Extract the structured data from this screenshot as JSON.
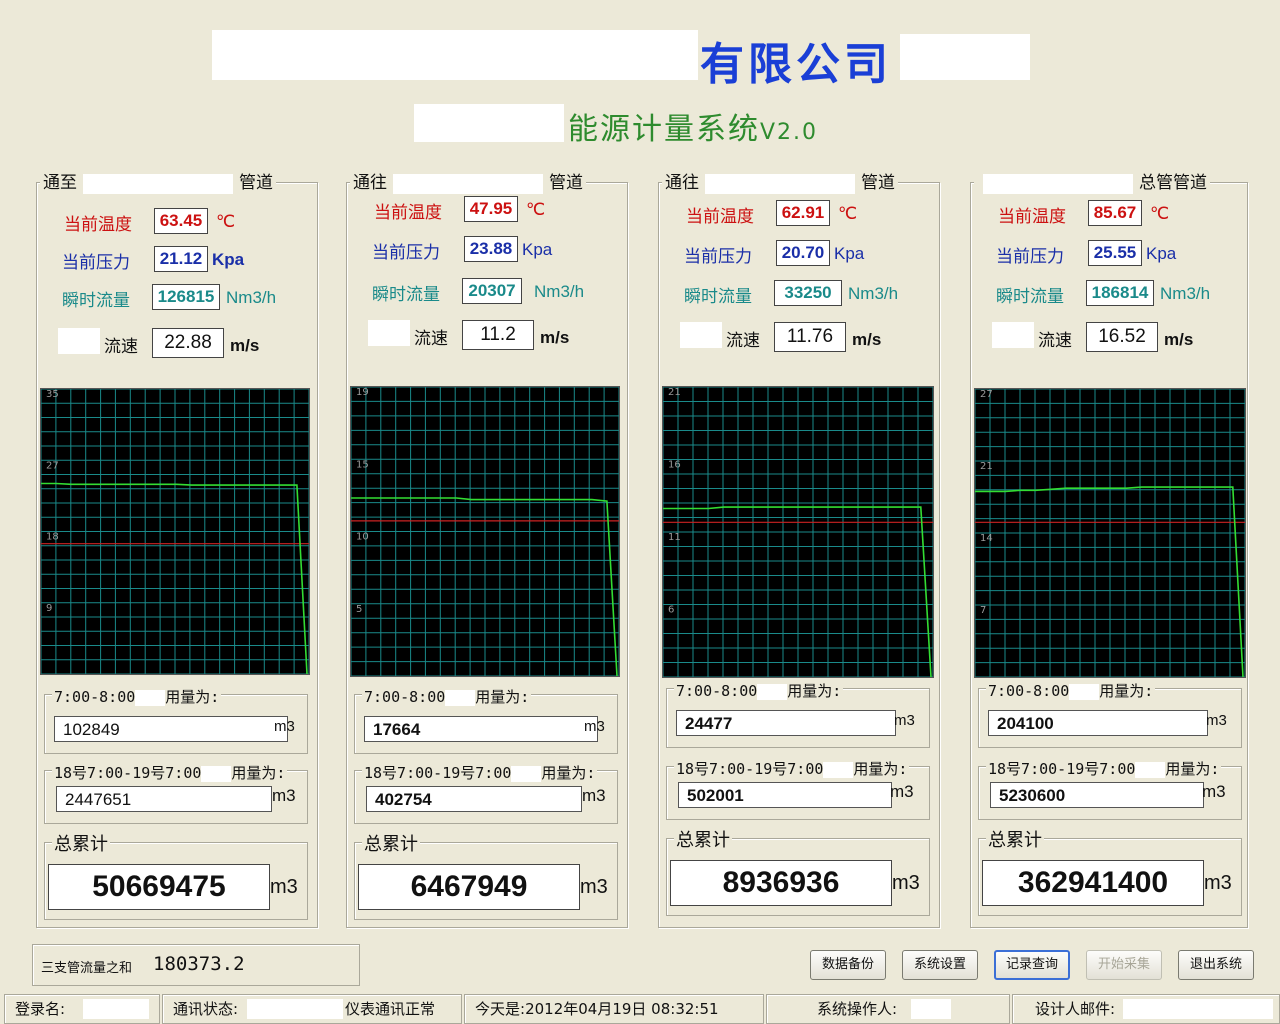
{
  "header": {
    "company": "有限公司",
    "system": "能源计量系统",
    "version": "V2.0"
  },
  "panels": [
    {
      "title_pre": "通至",
      "title_post": "管道",
      "temp_label": "当前温度",
      "temp": "63.45",
      "temp_unit": "℃",
      "pressure_label": "当前压力",
      "pressure": "21.12",
      "pressure_unit": "Kpa",
      "flow_label": "瞬时流量",
      "flow": "126815",
      "flow_unit": "Nm3/h",
      "speed_label": "流速",
      "speed": "22.88",
      "speed_unit": "m/s",
      "hour_label": "7:00-8:00",
      "hour_suffix": "用量为:",
      "hour_value": "102849",
      "day_label": "18号7:00-19号7:00",
      "day_suffix": "用量为:",
      "day_value": "2447651",
      "total_label": "总累计",
      "total": "50669475",
      "unit": "m3"
    },
    {
      "title_pre": "通往",
      "title_post": "管道",
      "temp_label": "当前温度",
      "temp": "47.95",
      "temp_unit": "℃",
      "pressure_label": "当前压力",
      "pressure": "23.88",
      "pressure_unit": "Kpa",
      "flow_label": "瞬时流量",
      "flow": "20307",
      "flow_unit": "Nm3/h",
      "speed_label": "流速",
      "speed": "11.2",
      "speed_unit": "m/s",
      "hour_label": "7:00-8:00",
      "hour_suffix": "用量为:",
      "hour_value": "17664",
      "day_label": "18号7:00-19号7:00",
      "day_suffix": "用量为:",
      "day_value": "402754",
      "total_label": "总累计",
      "total": "6467949",
      "unit": "m3"
    },
    {
      "title_pre": "通往",
      "title_post": "管道",
      "temp_label": "当前温度",
      "temp": "62.91",
      "temp_unit": "℃",
      "pressure_label": "当前压力",
      "pressure": "20.70",
      "pressure_unit": "Kpa",
      "flow_label": "瞬时流量",
      "flow": "33250",
      "flow_unit": "Nm3/h",
      "speed_label": "流速",
      "speed": "11.76",
      "speed_unit": "m/s",
      "hour_label": "7:00-8:00",
      "hour_suffix": "用量为:",
      "hour_value": "24477",
      "day_label": "18号7:00-19号7:00",
      "day_suffix": "用量为:",
      "day_value": "502001",
      "total_label": "总累计",
      "total": "8936936",
      "unit": "m3"
    },
    {
      "title_pre": "",
      "title_post": "总管管道",
      "temp_label": "当前温度",
      "temp": "85.67",
      "temp_unit": "℃",
      "pressure_label": "当前压力",
      "pressure": "25.55",
      "pressure_unit": "Kpa",
      "flow_label": "瞬时流量",
      "flow": "186814",
      "flow_unit": "Nm3/h",
      "speed_label": "流速",
      "speed": "16.52",
      "speed_unit": "m/s",
      "hour_label": "7:00-8:00",
      "hour_suffix": "用量为:",
      "hour_value": "204100",
      "day_label": "18号7:00-19号7:00",
      "day_suffix": "用量为:",
      "day_value": "5230600",
      "total_label": "总累计",
      "total": "362941400",
      "unit": "m3"
    }
  ],
  "chart_data": [
    {
      "type": "line",
      "yticks": [
        "35",
        "27",
        "18",
        "9"
      ],
      "ylim": [
        0,
        35
      ],
      "threshold": 16,
      "grid": true,
      "colors": {
        "grid": "#1a8a8a",
        "line": "#33dd33",
        "threshold": "#cc2222"
      },
      "series": [
        {
          "values": [
            23.4,
            23.4,
            23.3,
            23.3,
            23.3,
            23.3,
            23.3,
            23.3,
            23.3,
            23.3,
            23.2,
            23.2,
            23.2,
            23.2,
            23.2,
            23.2,
            23.2,
            23.2,
            0
          ]
        }
      ]
    },
    {
      "type": "line",
      "yticks": [
        "19",
        "15",
        "10",
        "5"
      ],
      "ylim": [
        0,
        19
      ],
      "threshold": 10.2,
      "grid": true,
      "colors": {
        "grid": "#1a8a8a",
        "line": "#33dd33",
        "threshold": "#cc2222"
      },
      "series": [
        {
          "values": [
            11.7,
            11.7,
            11.7,
            11.7,
            11.7,
            11.7,
            11.7,
            11.7,
            11.6,
            11.6,
            11.6,
            11.6,
            11.6,
            11.6,
            11.6,
            11.6,
            11.6,
            11.5,
            0
          ]
        }
      ]
    },
    {
      "type": "line",
      "yticks": [
        "21",
        "16",
        "11",
        "6"
      ],
      "ylim": [
        0,
        21
      ],
      "threshold": 11.2,
      "grid": true,
      "colors": {
        "grid": "#1a8a8a",
        "line": "#33dd33",
        "threshold": "#cc2222"
      },
      "series": [
        {
          "values": [
            12.2,
            12.2,
            12.2,
            12.2,
            12.3,
            12.3,
            12.3,
            12.3,
            12.3,
            12.3,
            12.3,
            12.3,
            12.3,
            12.3,
            12.3,
            12.3,
            12.3,
            12.3,
            0
          ]
        }
      ]
    },
    {
      "type": "line",
      "yticks": [
        "27",
        "21",
        "14",
        "7"
      ],
      "ylim": [
        0,
        27
      ],
      "threshold": 14.5,
      "grid": true,
      "colors": {
        "grid": "#1a8a8a",
        "line": "#33dd33",
        "threshold": "#cc2222"
      },
      "series": [
        {
          "values": [
            17.4,
            17.4,
            17.4,
            17.5,
            17.5,
            17.6,
            17.7,
            17.7,
            17.7,
            17.7,
            17.7,
            17.8,
            17.8,
            17.8,
            17.8,
            17.8,
            17.8,
            17.8,
            0
          ]
        }
      ]
    }
  ],
  "summary": {
    "label": "三支管流量之和",
    "value": "180373.2"
  },
  "buttons": [
    {
      "label": "数据备份",
      "state": "normal"
    },
    {
      "label": "系统设置",
      "state": "normal"
    },
    {
      "label": "记录查询",
      "state": "focus"
    },
    {
      "label": "开始采集",
      "state": "disabled"
    },
    {
      "label": "退出系统",
      "state": "normal"
    }
  ],
  "statusbar": {
    "login": "登录名:",
    "comm_label": "通讯状态:",
    "comm_value": "仪表通讯正常",
    "today_label": "今天是:",
    "today_value": "2012年04月19日 08:32:51",
    "operator": "系统操作人:",
    "email": "设计人邮件:"
  }
}
